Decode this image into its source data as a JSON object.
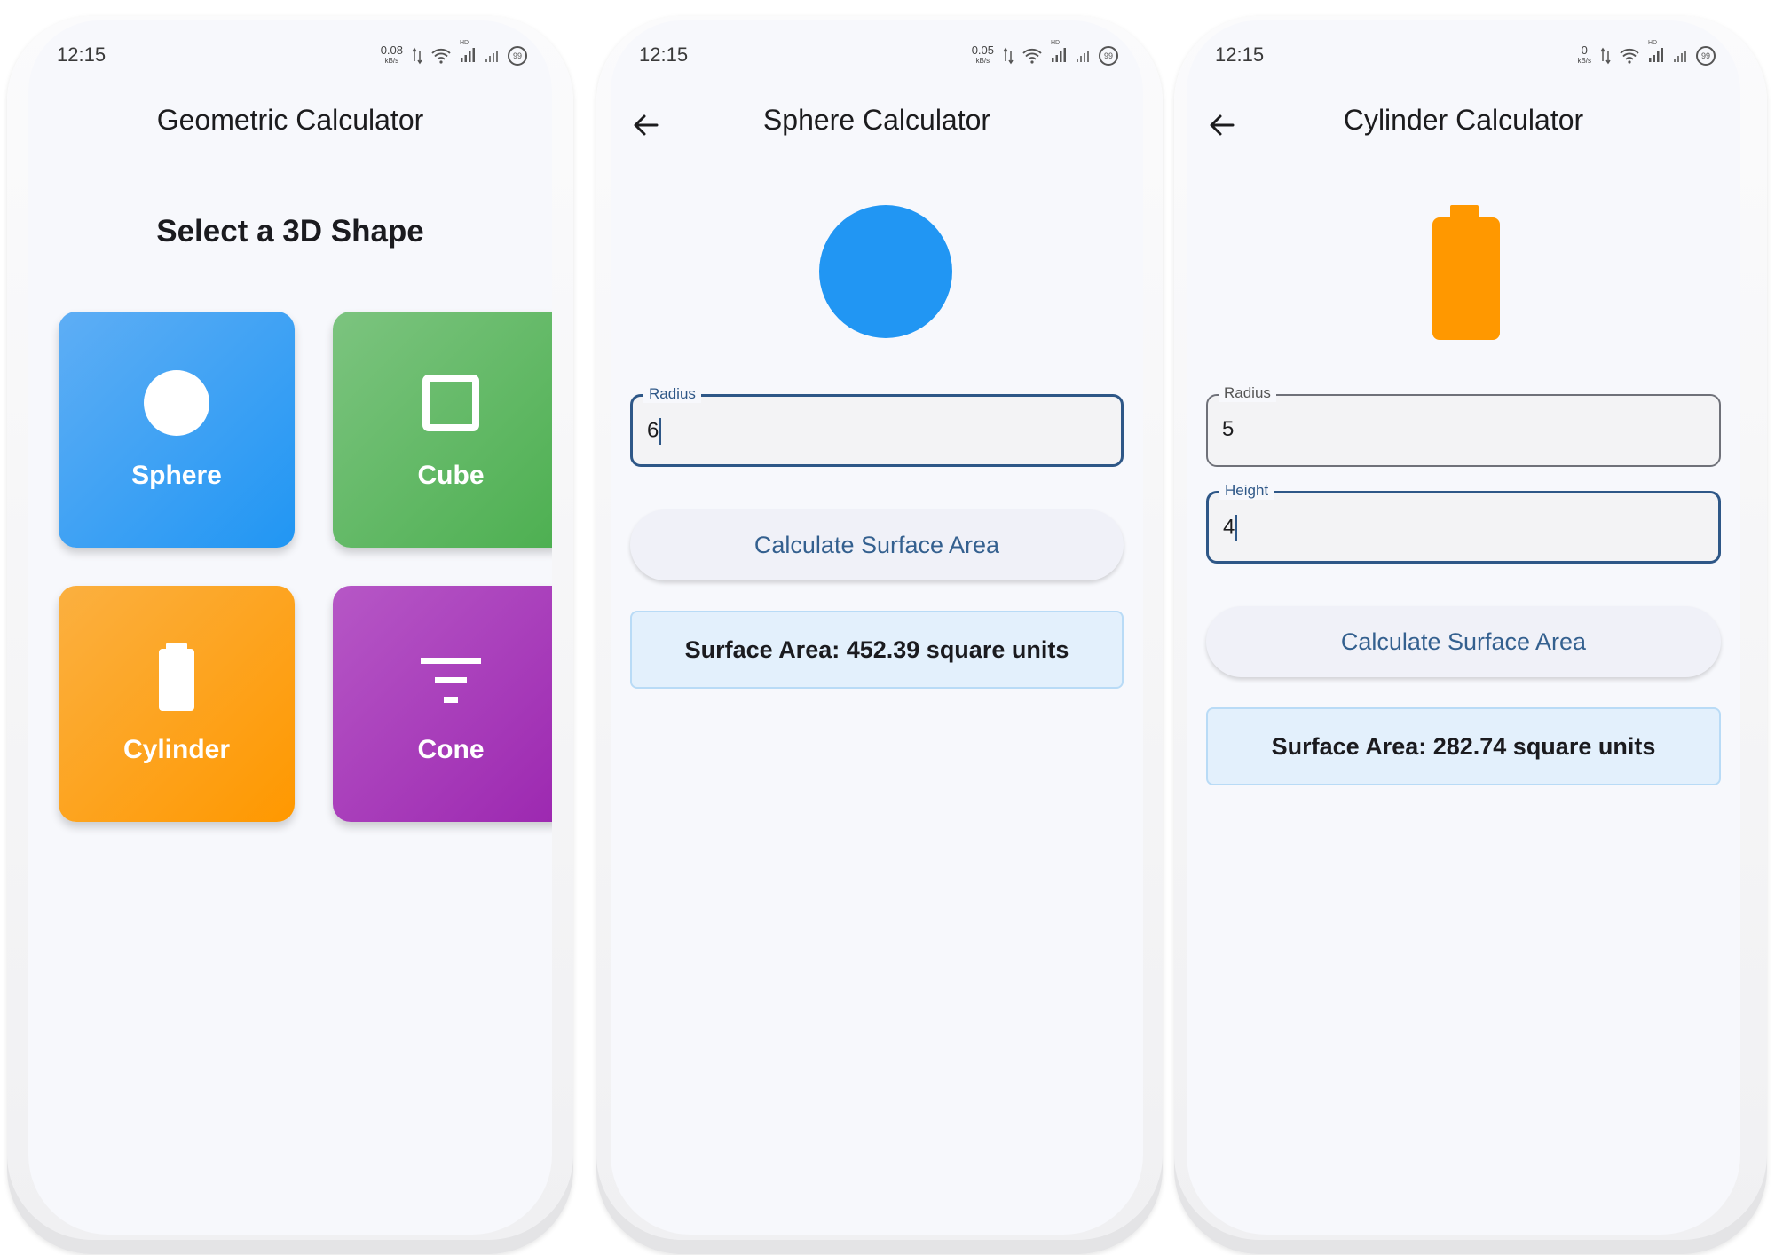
{
  "status": {
    "time": "12:15",
    "speeds": [
      "0.08",
      "0.05",
      "0"
    ],
    "speed_unit": "kB/s",
    "hd": "HD",
    "battery": "99"
  },
  "screen1": {
    "title": "Geometric Calculator",
    "heading": "Select a 3D Shape",
    "tiles": [
      {
        "label": "Sphere",
        "icon": "circle-icon",
        "color": "#2196F3"
      },
      {
        "label": "Cube",
        "icon": "square-outline-icon",
        "color": "#4CAF50"
      },
      {
        "label": "Cylinder",
        "icon": "cylinder-icon",
        "color": "#FF9800"
      },
      {
        "label": "Cone",
        "icon": "filter-icon",
        "color": "#9C27B0"
      }
    ]
  },
  "screen2": {
    "title": "Sphere Calculator",
    "shape_color": "#2196F3",
    "fields": [
      {
        "label": "Radius",
        "value": "6"
      }
    ],
    "button": "Calculate Surface Area",
    "result": "Surface Area: 452.39 square units"
  },
  "screen3": {
    "title": "Cylinder Calculator",
    "shape_color": "#FF9800",
    "fields": [
      {
        "label": "Radius",
        "value": "5"
      },
      {
        "label": "Height",
        "value": "4"
      }
    ],
    "button": "Calculate Surface Area",
    "result": "Surface Area: 282.74 square units"
  }
}
